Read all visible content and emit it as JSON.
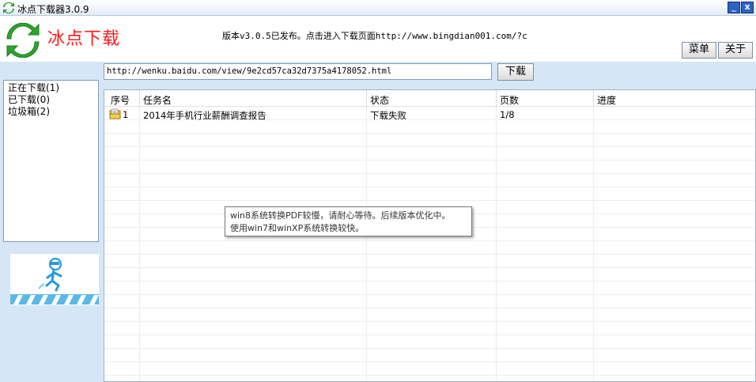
{
  "window": {
    "title": "冰点下载器3.0.9",
    "min_label": "_",
    "close_label": "x"
  },
  "header": {
    "logo_text": "冰点下载",
    "notice": "版本v3.0.5已发布。点击进入下载页面http://www.bingdian001.com/?c",
    "menu_label": "菜单",
    "about_label": "关于"
  },
  "toolbar": {
    "url_value": "http://wenku.baidu.com/view/9e2cd57ca32d7375a4178052.html",
    "download_label": "下载"
  },
  "sidebar": {
    "items": [
      {
        "label": "正在下载(1)"
      },
      {
        "label": "已下载(0)"
      },
      {
        "label": "垃圾箱(2)"
      }
    ]
  },
  "table": {
    "columns": [
      "序号",
      "任务名",
      "状态",
      "页数",
      "进度"
    ],
    "rows": [
      {
        "index": "1",
        "name": "2014年手机行业薪酬调查报告",
        "status": "下载失败",
        "pages": "1/8",
        "progress": ""
      }
    ]
  },
  "tooltip": {
    "line1": "win8系统转换PDF较慢，请耐心等待。后续版本优化中。",
    "line2": "使用win7和winXP系统转换较快。"
  },
  "colors": {
    "logo_red": "#ff1a1a",
    "titlebar_button": "#2f62c6",
    "background": "#d6e6f6"
  }
}
